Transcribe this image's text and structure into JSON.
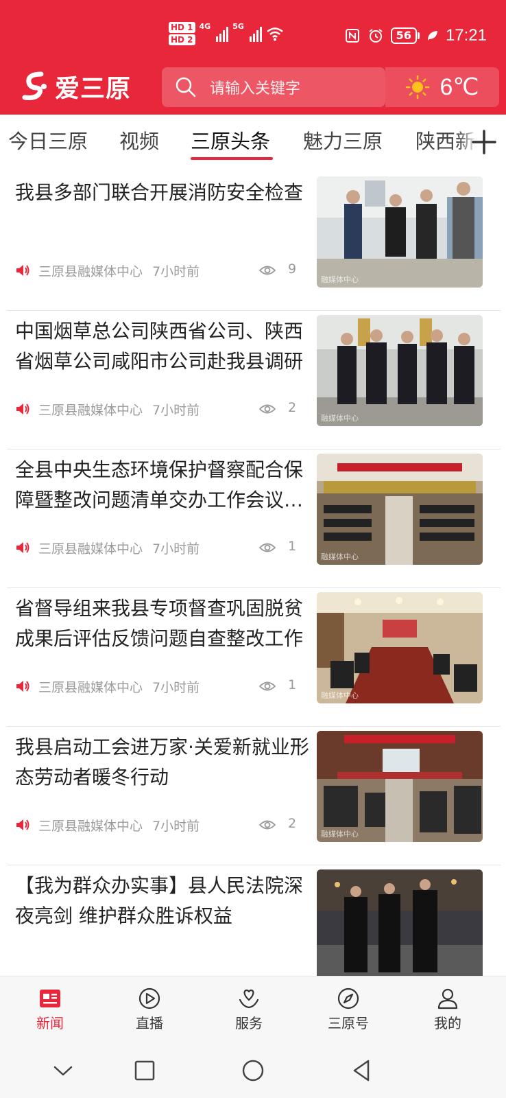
{
  "status_bar": {
    "hd1": "HD 1",
    "hd2": "HD 2",
    "net1": "4G",
    "net2": "5G",
    "battery": "56",
    "time": "17:21"
  },
  "header": {
    "logo_text": "爱三原",
    "search_placeholder": "请输入关键字",
    "weather_temp": "6℃",
    "weather_icon": "sun-icon",
    "accent_color": "#e8283a"
  },
  "tabs": [
    {
      "label": "今日三原"
    },
    {
      "label": "视频"
    },
    {
      "label": "三原头条",
      "active": true
    },
    {
      "label": "魅力三原"
    },
    {
      "label": "陕西新"
    }
  ],
  "articles": [
    {
      "title": "我县多部门联合开展消防安全检查",
      "source": "三原县融媒体中心",
      "time": "7小时前",
      "views": "9",
      "watermark": "融媒体中心"
    },
    {
      "title": "中国烟草总公司陕西省公司、陕西省烟草公司咸阳市公司赴我县调研",
      "source": "三原县融媒体中心",
      "time": "7小时前",
      "views": "2",
      "watermark": "融媒体中心"
    },
    {
      "title": "全县中央生态环境保护督察配合保障暨整改问题清单交办工作会议召开",
      "source": "三原县融媒体中心",
      "time": "7小时前",
      "views": "1",
      "watermark": "融媒体中心"
    },
    {
      "title": "省督导组来我县专项督查巩固脱贫成果后评估反馈问题自查整改工作",
      "source": "三原县融媒体中心",
      "time": "7小时前",
      "views": "1",
      "watermark": "融媒体中心"
    },
    {
      "title": "我县启动工会进万家·关爱新就业形态劳动者暖冬行动",
      "source": "三原县融媒体中心",
      "time": "7小时前",
      "views": "2",
      "watermark": "融媒体中心"
    },
    {
      "title": "【我为群众办实事】县人民法院深夜亮剑 维护群众胜诉权益",
      "source": "",
      "time": "",
      "views": "",
      "watermark": ""
    }
  ],
  "bottom_nav": [
    {
      "label": "新闻",
      "icon": "news-icon",
      "active": true
    },
    {
      "label": "直播",
      "icon": "play-icon"
    },
    {
      "label": "服务",
      "icon": "service-icon"
    },
    {
      "label": "三原号",
      "icon": "compass-icon"
    },
    {
      "label": "我的",
      "icon": "user-icon"
    }
  ]
}
